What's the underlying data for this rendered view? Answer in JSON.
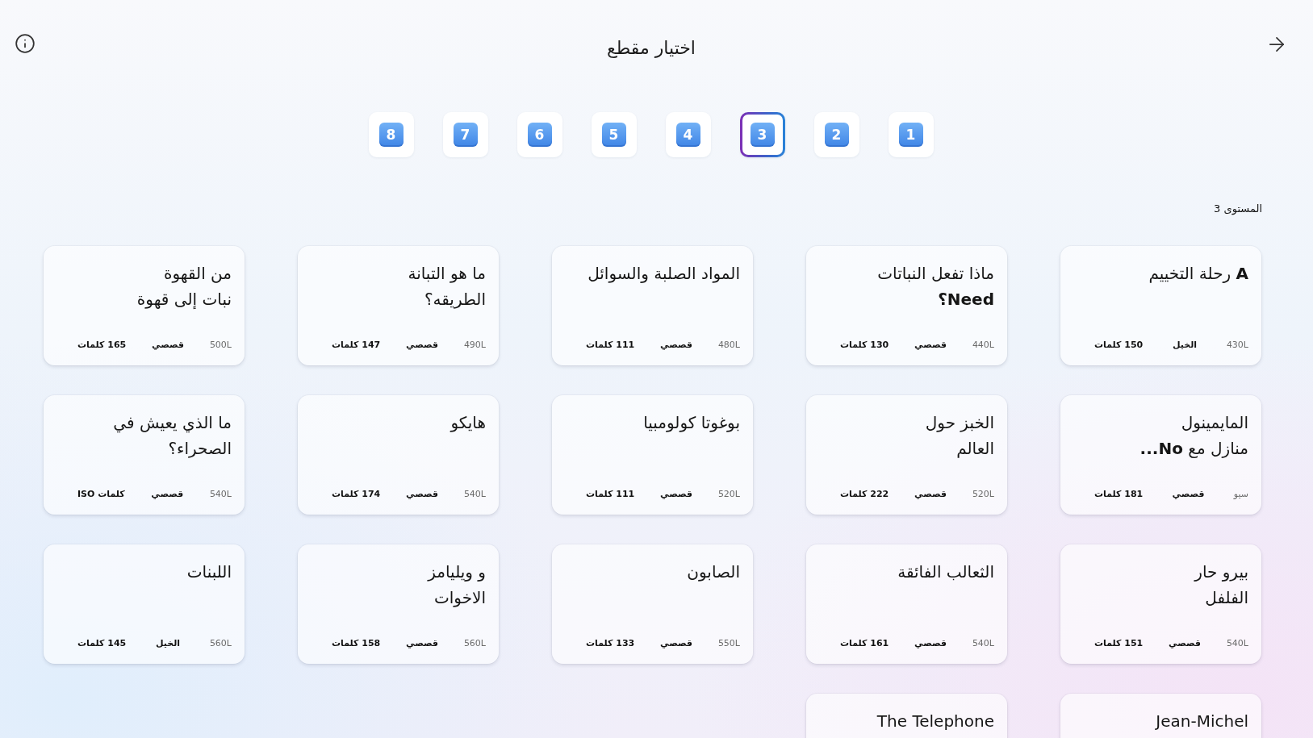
{
  "header": {
    "title": "اختيار مقطع"
  },
  "levels": [
    {
      "label": "1",
      "selected": false
    },
    {
      "label": "2",
      "selected": false
    },
    {
      "label": "3",
      "selected": true
    },
    {
      "label": "4",
      "selected": false
    },
    {
      "label": "5",
      "selected": false
    },
    {
      "label": "6",
      "selected": false
    },
    {
      "label": "7",
      "selected": false
    },
    {
      "label": "8",
      "selected": false
    }
  ],
  "level_label": "المستوى 3",
  "passages": [
    {
      "title": "**A** رحلة التخييم",
      "lexile": "430L",
      "genre": "الخيل",
      "word_count": "150 كلمات"
    },
    {
      "title": "ماذا تفعل النباتات\n**Need؟**",
      "lexile": "440L",
      "genre": "قصصي",
      "word_count": "130 كلمات"
    },
    {
      "title": "المواد الصلبة والسوائل",
      "lexile": "480L",
      "genre": "قصصي",
      "word_count": "111 كلمات"
    },
    {
      "title": "ما هو التبانة\nالطريقه؟",
      "lexile": "490L",
      "genre": "قصصي",
      "word_count": "147 كلمات"
    },
    {
      "title": "من القهوة\nنبات إلى قهوة",
      "lexile": "500L",
      "genre": "قصصي",
      "word_count": "165 كلمات"
    },
    {
      "title": "المايمينول\nمنازل مع **No...**",
      "lexile": "سيو",
      "genre": "قصصي",
      "word_count": "181 كلمات"
    },
    {
      "title": "الخبز حول\nالعالم",
      "lexile": "520L",
      "genre": "قصصي",
      "word_count": "222 كلمات"
    },
    {
      "title": "بوغوتا كولومبيا",
      "lexile": "520L",
      "genre": "قصصي",
      "word_count": "111 كلمات"
    },
    {
      "title": "هايكو",
      "lexile": "540L",
      "genre": "قصصي",
      "word_count": "174 كلمات"
    },
    {
      "title": "ما الذي يعيش في\nالصحراء؟",
      "lexile": "540L",
      "genre": "قصصي",
      "word_count": "كلمات ISO"
    },
    {
      "title": "بيرو حار\nالفلفل",
      "lexile": "540L",
      "genre": "قصصي",
      "word_count": "151 كلمات"
    },
    {
      "title": "الثعالب الفائقة",
      "lexile": "540L",
      "genre": "قصصي",
      "word_count": "161 كلمات"
    },
    {
      "title": "الصابون",
      "lexile": "550L",
      "genre": "قصصي",
      "word_count": "133 كلمات"
    },
    {
      "title": "و ويليامز\nالاخوات",
      "lexile": "560L",
      "genre": "قصصي",
      "word_count": "158 كلمات"
    },
    {
      "title": "اللبنات",
      "lexile": "560L",
      "genre": "الخيل",
      "word_count": "145 كلمات"
    },
    {
      "title": "Jean-Michel"
    },
    {
      "title": "The Telephone"
    }
  ]
}
